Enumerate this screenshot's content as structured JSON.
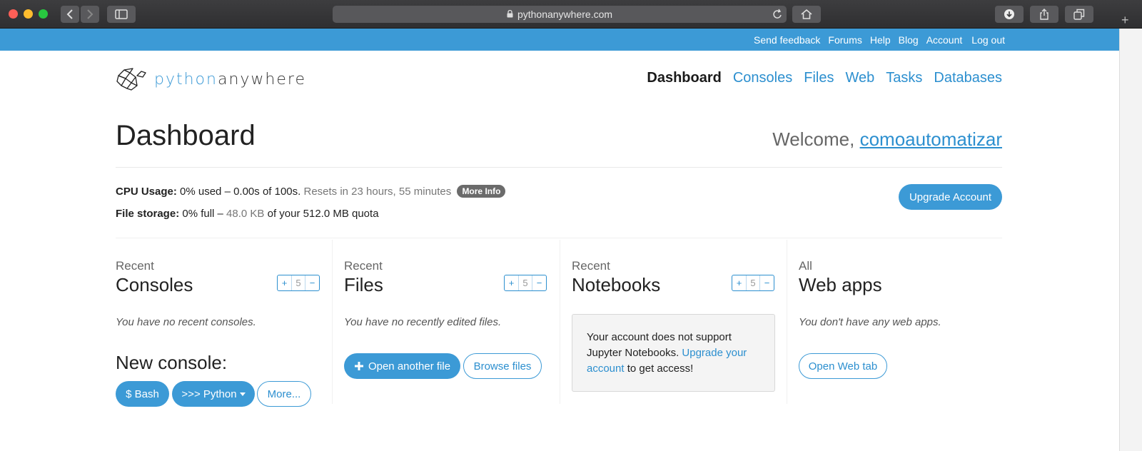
{
  "browser": {
    "url": "pythonanywhere.com"
  },
  "topbar": {
    "links": [
      "Send feedback",
      "Forums",
      "Help",
      "Blog",
      "Account",
      "Log out"
    ]
  },
  "header": {
    "logo_python": "python",
    "logo_anywhere": "anywhere",
    "nav": [
      "Dashboard",
      "Consoles",
      "Files",
      "Web",
      "Tasks",
      "Databases"
    ],
    "active_nav": "Dashboard"
  },
  "page": {
    "title": "Dashboard",
    "welcome_prefix": "Welcome, ",
    "username": "comoautomatizar"
  },
  "usage": {
    "cpu_label": "CPU Usage:",
    "cpu_value": " 0% used – 0.00s of 100s.",
    "cpu_reset": " Resets in 23 hours, 55 minutes",
    "more_info": "More Info",
    "storage_label": "File storage:",
    "storage_pct": " 0% full –",
    "storage_used": " 48.0 KB",
    "storage_quota": " of your 512.0 MB quota",
    "upgrade_button": "Upgrade Account"
  },
  "columns": {
    "consoles": {
      "kicker": "Recent",
      "heading": "Consoles",
      "count": "5",
      "empty": "You have no recent consoles.",
      "new_console_label": "New console:",
      "buttons": [
        "$ Bash",
        ">>> Python",
        "More..."
      ]
    },
    "files": {
      "kicker": "Recent",
      "heading": "Files",
      "count": "5",
      "empty": "You have no recently edited files.",
      "open_button": "Open another file",
      "browse_button": "Browse files"
    },
    "notebooks": {
      "kicker": "Recent",
      "heading": "Notebooks",
      "count": "5",
      "notice_text": "Your account does not support Jupyter Notebooks. ",
      "notice_link": "Upgrade your account",
      "notice_suffix": " to get access!"
    },
    "webapps": {
      "kicker": "All",
      "heading": "Web apps",
      "empty": "You don't have any web apps.",
      "open_button": "Open Web tab"
    }
  },
  "stepper": {
    "plus": "+",
    "minus": "−"
  },
  "colors": {
    "brand_blue": "#3c9ad6",
    "link_blue": "#2c8fcf"
  }
}
